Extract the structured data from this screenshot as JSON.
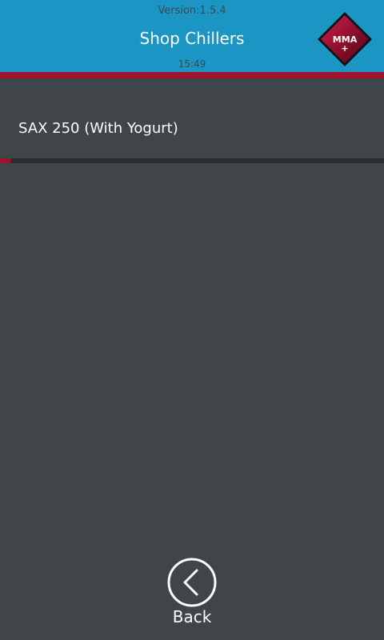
{
  "header": {
    "version": "Version:1.5.4",
    "title": "Shop Chillers",
    "time": "15:49",
    "logo_text": "MMA",
    "logo_plus": "+"
  },
  "list": {
    "items": [
      {
        "label": "SAX 250 (With Yogurt)"
      }
    ]
  },
  "footer": {
    "back_label": "Back"
  },
  "colors": {
    "header_bg": "#1b96c4",
    "accent_red": "#a3122f",
    "body_bg": "#3f4548",
    "text_white": "#ffffff"
  },
  "icons": {
    "logo": "mma-logo-icon",
    "back": "back-chevron-icon"
  }
}
